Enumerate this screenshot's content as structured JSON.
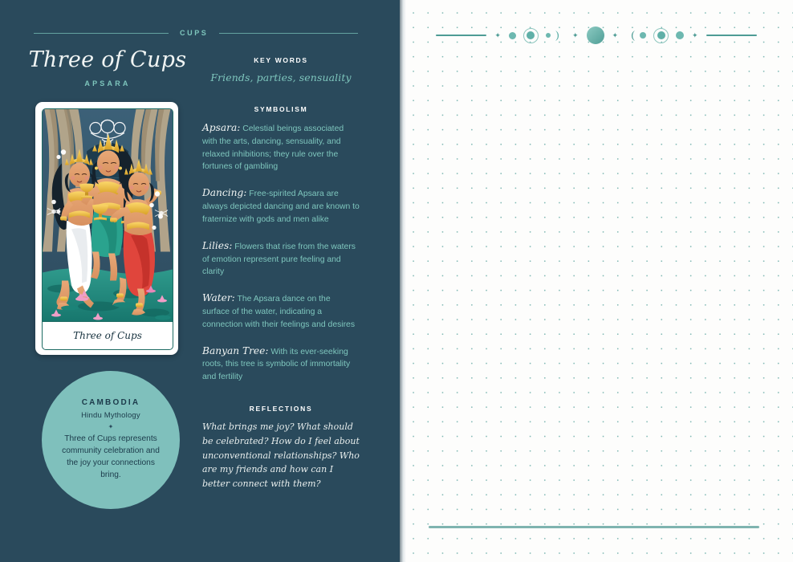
{
  "left_page": {
    "suit_label": "CUPS",
    "card_title": "Three of Cups",
    "card_subtitle": "APSARA",
    "card_image": {
      "caption": "Three of Cups",
      "alt": "Three Apsara dancers in golden crowns holding cups, standing in a lotus pond before a banyan tree and stone temple arch"
    },
    "origin_badge": {
      "country": "CAMBODIA",
      "mythology": "Hindu Mythology",
      "separator": "✦",
      "meaning": "Three of Cups represents community celebration and the joy your connections bring."
    },
    "key_words": {
      "heading": "KEY WORDS",
      "value": "Friends, parties, sensuality"
    },
    "symbolism": {
      "heading": "SYMBOLISM",
      "items": [
        {
          "term": "Apsara:",
          "text": " Celestial beings associated with the arts, dancing, sensuality, and relaxed inhibitions; they rule over the fortunes of gambling"
        },
        {
          "term": "Dancing:",
          "text": " Free-spirited Apsara are always depicted dancing and are known to fraternize with gods and men alike"
        },
        {
          "term": "Lilies:",
          "text": " Flowers that rise from the waters of emotion represent pure feeling and clarity"
        },
        {
          "term": "Water:",
          "text": " The Apsara dance on the surface of the water, indicating a connection with their feelings and desires"
        },
        {
          "term": "Banyan Tree:",
          "text": " With its ever-seeking roots, this tree is symbolic of immortality and fertility"
        }
      ]
    },
    "reflections": {
      "heading": "REFLECTIONS",
      "prompt": "What brings me joy? What should be celebrated? How do I feel about unconventional relationships? Who are my friends and how can I better connect with them?"
    }
  },
  "right_page": {
    "decoration": "moon-phase-divider",
    "note_area": "dotted-grid",
    "bottom_rule": true
  },
  "colors": {
    "page_background": "#2a4a5c",
    "accent_teal": "#7ec6bd",
    "rule_teal": "#6fb3ab",
    "badge_fill": "#7fc0bc",
    "notes_paper": "#fdfdfc",
    "dot_grid": "#7fb8b3",
    "moon_teal": "#4e9c95",
    "heading_white": "#ffffff",
    "card_border": "#1d6b63"
  }
}
